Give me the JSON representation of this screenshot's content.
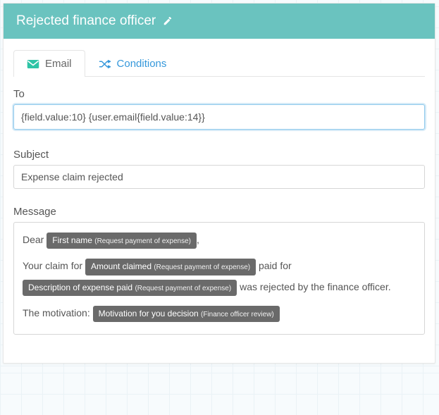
{
  "header": {
    "title": "Rejected finance officer"
  },
  "tabs": {
    "email": "Email",
    "conditions": "Conditions"
  },
  "to": {
    "label": "To",
    "value": "{field.value:10} {user.email{field.value:14}}"
  },
  "subject": {
    "label": "Subject",
    "value": "Expense claim rejected"
  },
  "message": {
    "label": "Message",
    "text": {
      "dear": "Dear ",
      "comma": ",",
      "claim_for": "Your claim for ",
      "paid_for": " paid for ",
      "rejected": " was rejected by the finance officer.",
      "motivation_label": "The motivation: "
    },
    "chips": {
      "first_name": {
        "main": "First name ",
        "sub": "(Request payment of expense)"
      },
      "amount": {
        "main": "Amount claimed ",
        "sub": "(Request payment of expense)"
      },
      "description": {
        "main": "Description of expense paid ",
        "sub": "(Request payment of expense)"
      },
      "motivation": {
        "main": "Motivation for you decision ",
        "sub": "(Finance officer review)"
      }
    }
  }
}
